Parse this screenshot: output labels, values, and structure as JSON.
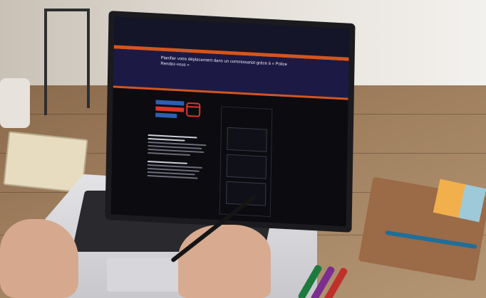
{
  "scene": {
    "objects": [
      "laptop-icon",
      "notebook-icon",
      "pen-icon",
      "stylus-icon",
      "sticky-notes-icon",
      "newtons-cradle-icon",
      "mug-icon",
      "marker-icon"
    ]
  },
  "screen": {
    "hero_title": "Planifier votre déplacement dans un commissariat grâce à « Police Rendez-vous »",
    "logo_text": "POLICE RENDEZ-VOUS",
    "section_title": "Préparer votre venue dans un commissariat",
    "sidebar_title": "Nos actualités"
  },
  "colors": {
    "accent": "#d3561e",
    "hero_bg": "#1c1a45",
    "logo_blue": "#2d5fb0",
    "logo_red": "#d9362b"
  }
}
